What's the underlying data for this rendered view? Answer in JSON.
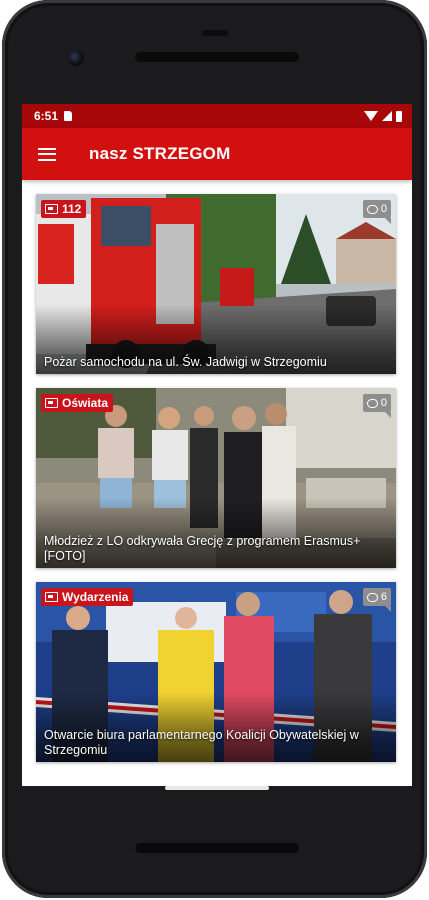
{
  "status_bar": {
    "time": "6:51"
  },
  "app_bar": {
    "title": "nasz STRZEGOM",
    "menu_icon": "hamburger-menu-icon"
  },
  "articles": [
    {
      "category": "112",
      "comments": "0",
      "title": "Pożar samochodu na ul. Św. Jadwigi w Strzegomiu"
    },
    {
      "category": "Oświata",
      "comments": "0",
      "title": "Młodzież z LO odkrywała Grecję z programem Erasmus+ [FOTO]"
    },
    {
      "category": "Wydarzenia",
      "comments": "6",
      "title": "Otwarcie biura parlamentarnego Koalicji Obywatelskiej w Strzegomiu"
    }
  ],
  "colors": {
    "status_bar": "#a8070a",
    "app_bar": "#d1100f",
    "badge": "#c8141a"
  }
}
